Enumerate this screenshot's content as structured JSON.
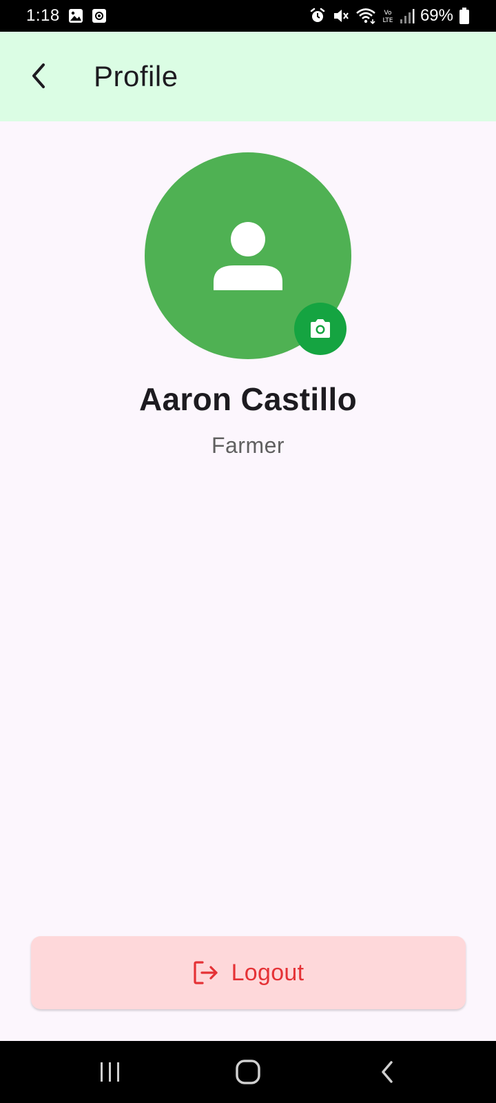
{
  "status_bar": {
    "time": "1:18",
    "battery": "69%",
    "icons": [
      "image-icon",
      "screen-record-icon",
      "alarm-icon",
      "mute-icon",
      "wifi-icon",
      "volte-icon",
      "signal-icon",
      "battery-icon"
    ]
  },
  "app_bar": {
    "title": "Profile",
    "background": "#dbfde4"
  },
  "profile": {
    "name": "Aaron Castillo",
    "role": "Farmer",
    "avatar_color": "#4fb153",
    "camera_button_color": "#15a441"
  },
  "logout": {
    "label": "Logout",
    "text_color": "#e53236",
    "background": "#fed8da"
  },
  "nav_bar": {
    "items": [
      "recent-apps-icon",
      "home-icon",
      "back-icon"
    ]
  }
}
